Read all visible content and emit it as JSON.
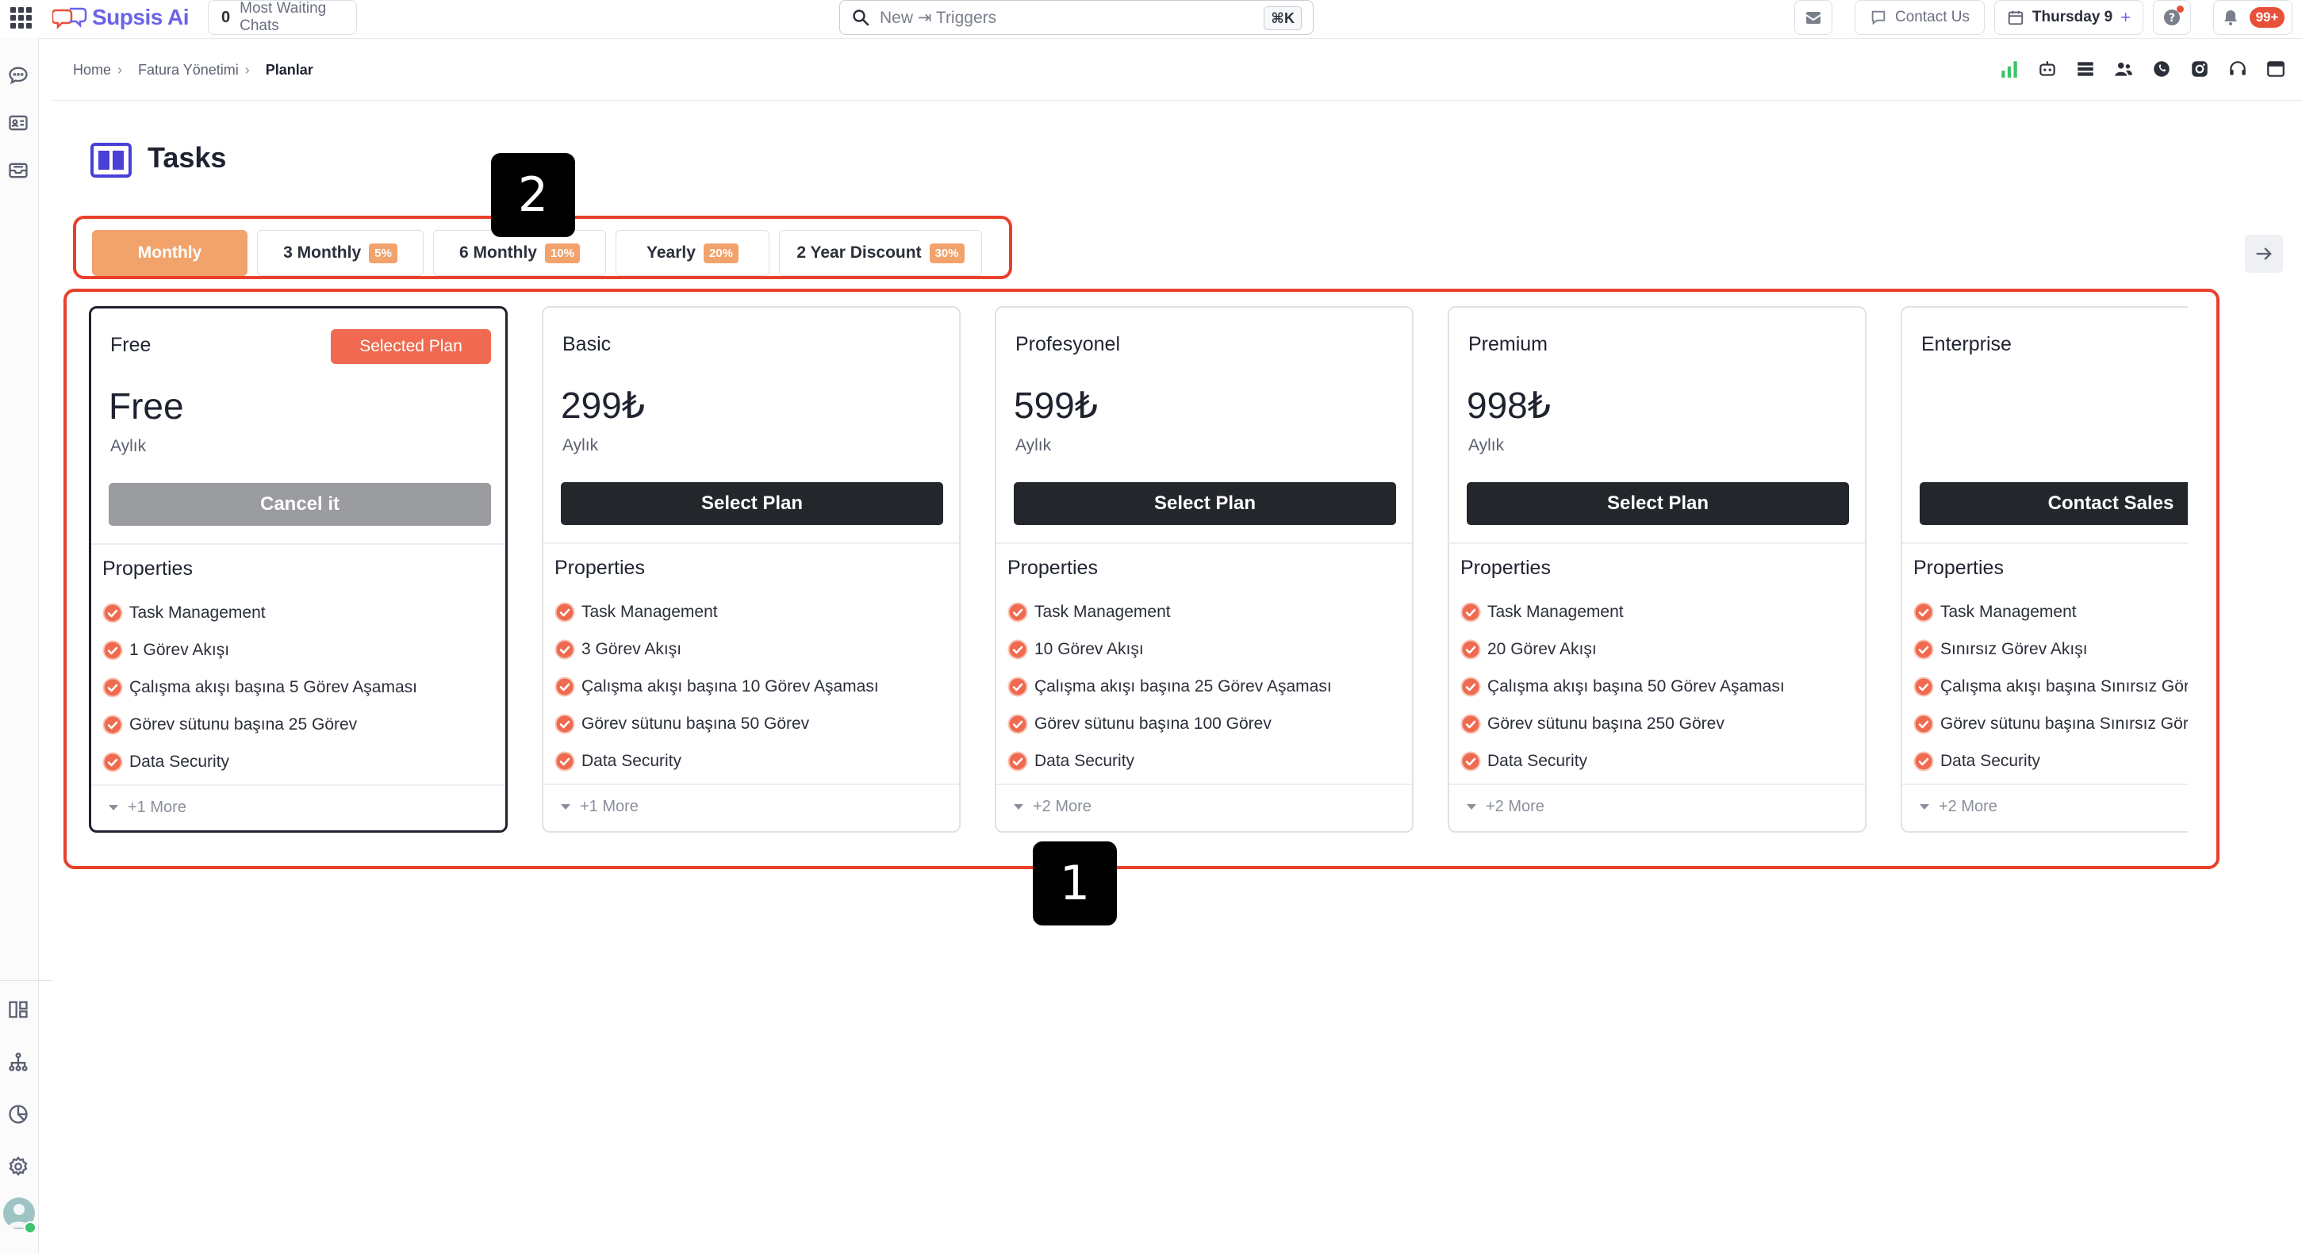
{
  "app": {
    "name": "Supsis Ai"
  },
  "topbar": {
    "waiting_count": "0",
    "waiting_label": "Most Waiting Chats",
    "search_placeholder": "New ⇥ Triggers",
    "search_shortcut": "⌘K",
    "contact_label": "Contact Us",
    "day_label": "Thursday 9",
    "day_plus": "+",
    "notif_count": "99+"
  },
  "breadcrumb": {
    "home": "Home",
    "billing": "Fatura Yönetimi",
    "current": "Planlar",
    "sep": "›"
  },
  "page": {
    "title": "Tasks"
  },
  "tabs": [
    {
      "label": "Monthly",
      "badge": ""
    },
    {
      "label": "3 Monthly",
      "badge": "5%"
    },
    {
      "label": "6 Monthly",
      "badge": "10%"
    },
    {
      "label": "Yearly",
      "badge": "20%"
    },
    {
      "label": "2 Year Discount",
      "badge": "30%"
    }
  ],
  "annotations": {
    "cards_number": "1",
    "tabs_number": "2"
  },
  "colors": {
    "accent": "#f2a26b",
    "brand": "#6a63e8",
    "annotation": "#e8402a",
    "selected_badge": "#ef6a50"
  },
  "plans": [
    {
      "name": "Free",
      "badge": "Selected Plan",
      "price": "Free",
      "period": "Aylık",
      "button": "Cancel it",
      "props_title": "Properties",
      "features": [
        "Task Management",
        "1 Görev Akışı",
        "Çalışma akışı başına 5 Görev Aşaması",
        "Görev sütunu başına 25 Görev",
        "Data Security"
      ],
      "more": "+1 More"
    },
    {
      "name": "Basic",
      "price": "299₺",
      "period": "Aylık",
      "button": "Select Plan",
      "props_title": "Properties",
      "features": [
        "Task Management",
        "3 Görev Akışı",
        "Çalışma akışı başına 10 Görev Aşaması",
        "Görev sütunu başına 50 Görev",
        "Data Security"
      ],
      "more": "+1 More"
    },
    {
      "name": "Profesyonel",
      "price": "599₺",
      "period": "Aylık",
      "button": "Select Plan",
      "props_title": "Properties",
      "features": [
        "Task Management",
        "10 Görev Akışı",
        "Çalışma akışı başına 25 Görev Aşaması",
        "Görev sütunu başına 100 Görev",
        "Data Security"
      ],
      "more": "+2 More"
    },
    {
      "name": "Premium",
      "price": "998₺",
      "period": "Aylık",
      "button": "Select Plan",
      "props_title": "Properties",
      "features": [
        "Task Management",
        "20 Görev Akışı",
        "Çalışma akışı başına 50 Görev Aşaması",
        "Görev sütunu başına 250 Görev",
        "Data Security"
      ],
      "more": "+2 More"
    },
    {
      "name": "Enterprise",
      "price": "",
      "period": "",
      "button": "Contact Sales",
      "props_title": "Properties",
      "features": [
        "Task Management",
        "Sınırsız Görev Akışı",
        "Çalışma akışı başına Sınırsız Görev Aşaması",
        "Görev sütunu başına Sınırsız Görev",
        "Data Security"
      ],
      "more": "+2 More"
    }
  ]
}
